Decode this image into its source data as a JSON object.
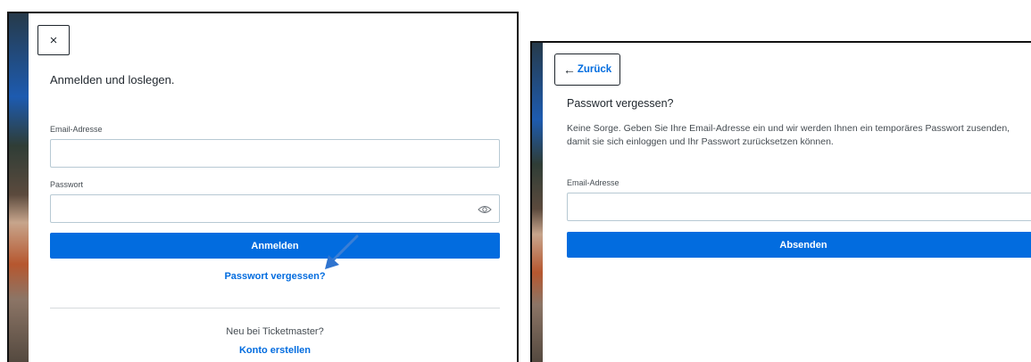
{
  "login": {
    "close_symbol": "×",
    "heading": "Anmelden und loslegen.",
    "email_label": "Email-Adresse",
    "email_value": "",
    "password_label": "Passwort",
    "password_value": "",
    "show_password_icon": "eye-icon",
    "submit_label": "Anmelden",
    "forgot_link": "Passwort vergessen?",
    "new_user_text": "Neu bei Ticketmaster?",
    "create_account_link": "Konto erstellen"
  },
  "forgot": {
    "back_arrow": "←",
    "back_label": "Zurück",
    "heading": "Passwort vergessen?",
    "description": "Keine Sorge. Geben Sie Ihre Email-Adresse ein und wir werden Ihnen ein temporäres Passwort zusenden, damit sie sich einloggen und Ihr Passwort zurücksetzen können.",
    "email_label": "Email-Adresse",
    "email_value": "",
    "submit_label": "Absenden"
  },
  "colors": {
    "accent": "#026cdf",
    "text": "#1f262d",
    "border": "#b7c9d3"
  }
}
